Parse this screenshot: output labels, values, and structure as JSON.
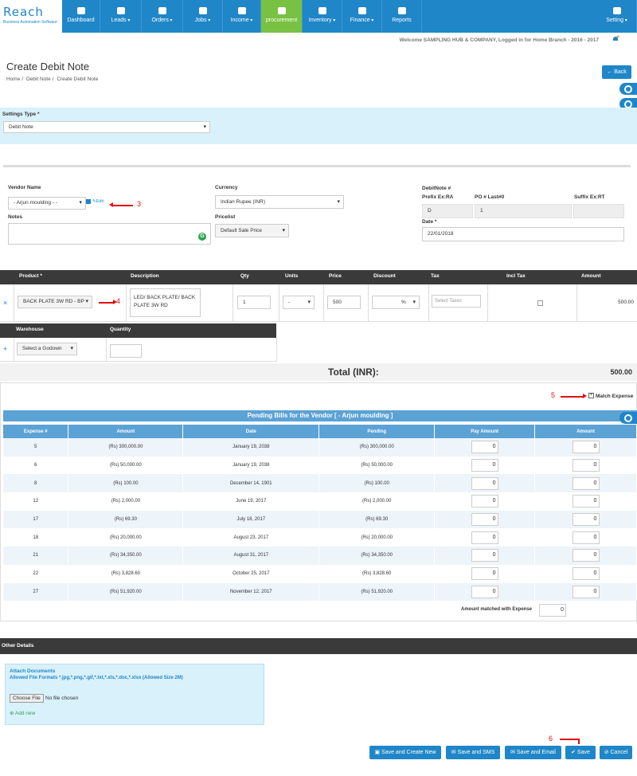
{
  "brand": {
    "logo": "Reach",
    "tagline": "Business Automation Software"
  },
  "nav": [
    {
      "label": "Dashboard",
      "icon": "dashboard-icon",
      "dropdown": false
    },
    {
      "label": "Leads",
      "icon": "leads-icon",
      "dropdown": true
    },
    {
      "label": "Orders",
      "icon": "orders-icon",
      "dropdown": true
    },
    {
      "label": "Jobs",
      "icon": "jobs-icon",
      "dropdown": true
    },
    {
      "label": "Income",
      "icon": "income-icon",
      "dropdown": true
    },
    {
      "label": "procurement",
      "icon": "procurement-icon",
      "dropdown": false
    },
    {
      "label": "Inventory",
      "icon": "inventory-icon",
      "dropdown": true
    },
    {
      "label": "Finance",
      "icon": "finance-icon",
      "dropdown": true
    },
    {
      "label": "Reports",
      "icon": "reports-icon",
      "dropdown": false
    },
    {
      "label": "Setting",
      "icon": "gear-icon",
      "dropdown": true
    }
  ],
  "welcome": "Welcome SAMPLING HUB & COMPANY, Logged in for Home Branch - 2016 - 2017",
  "page": {
    "title": "Create Debit Note",
    "breadcrumb": [
      "Home",
      "Debit Note",
      "Create Debit Note"
    ],
    "back_label": "Back"
  },
  "settings": {
    "label": "Settings Type *",
    "value": "Debit Note"
  },
  "form": {
    "vendor_label": "Vendor Name",
    "vendor_value": "- Arjun moulding - -",
    "edit_label": "Edit",
    "notes_label": "Notes",
    "currency_label": "Currency",
    "currency_value": "Indian Rupee (INR)",
    "pricelist_label": "Pricelist",
    "pricelist_value": "Default Sale Price",
    "debitnote_label": "DebitNote #",
    "prefix_label": "Prefix Ex:RA",
    "po_label": "PO # Last#0",
    "suffix_label": "Suffix Ex:RT",
    "prefix_value": "D",
    "po_value": "1",
    "suffix_value": "",
    "date_label": "Date *",
    "date_value": "22/01/2018"
  },
  "annotations": {
    "a3": "3",
    "a4": "4",
    "a5": "5",
    "a6": "6"
  },
  "products": {
    "headers": [
      "Product *",
      "Description",
      "Qty",
      "Units",
      "Price",
      "Discount",
      "Tax",
      "Incl Tax",
      "Amount"
    ],
    "row": {
      "product": "BACK PLATE 3W RD - BP",
      "description": "LED/ BACK PLATE/ BACK PLATE 3W RD",
      "qty": "1",
      "units": "-",
      "price": "500",
      "discount_type": "%",
      "tax_placeholder": "Select Taxes",
      "amount": "500.00"
    },
    "warehouse_headers": [
      "Warehouse",
      "Quantity"
    ],
    "warehouse_value": "Select a Godown"
  },
  "total": {
    "label": "Total (INR):",
    "value": "500.00"
  },
  "match_expense_label": "Match Expense",
  "pending": {
    "title": "Pending Bills for the Vendor [ - Arjun moulding ]",
    "headers": [
      "Expense #",
      "Amount",
      "Date",
      "Pending",
      "Pay Amount",
      "Amount"
    ],
    "rows": [
      {
        "expense": "5",
        "amount": "(Rs) 300,000.00",
        "date": "January 19, 2038",
        "pending": "(Rs) 300,000.00",
        "pay": "0",
        "amt": "0"
      },
      {
        "expense": "6",
        "amount": "(Rs) 50,000.00",
        "date": "January 19, 2038",
        "pending": "(Rs) 50,000.00",
        "pay": "0",
        "amt": "0"
      },
      {
        "expense": "8",
        "amount": "(Rs) 100.00",
        "date": "December 14, 1901",
        "pending": "(Rs) 100.00",
        "pay": "0",
        "amt": "0"
      },
      {
        "expense": "12",
        "amount": "(Rs) 2,000.00",
        "date": "June 19, 2017",
        "pending": "(Rs) 2,000.00",
        "pay": "0",
        "amt": "0"
      },
      {
        "expense": "17",
        "amount": "(Rs) 69.30",
        "date": "July 18, 2017",
        "pending": "(Rs) 69.30",
        "pay": "0",
        "amt": "0"
      },
      {
        "expense": "18",
        "amount": "(Rs) 20,000.00",
        "date": "August 23, 2017",
        "pending": "(Rs) 20,000.00",
        "pay": "0",
        "amt": "0"
      },
      {
        "expense": "21",
        "amount": "(Rs) 34,350.00",
        "date": "August 31, 2017",
        "pending": "(Rs) 34,350.00",
        "pay": "0",
        "amt": "0"
      },
      {
        "expense": "22",
        "amount": "(Rs) 3,828.60",
        "date": "October 25, 2017",
        "pending": "(Rs) 3,828.60",
        "pay": "0",
        "amt": "0"
      },
      {
        "expense": "27",
        "amount": "(Rs) 51,920.00",
        "date": "November 12, 2017",
        "pending": "(Rs) 51,920.00",
        "pay": "0",
        "amt": "0"
      }
    ],
    "matched_label": "Amount matched with Expense",
    "matched_value": "0"
  },
  "other": {
    "title": "Other Details",
    "attach_title": "Attach Documents",
    "attach_formats": "Allowed File Formats *.jpg,*.png,*.gif,*.txt,*.xls,*.doc,*.xlsx (Allowed Size 2M)",
    "choose_file": "Choose File",
    "no_file": "No file chosen",
    "add_new": "Add new"
  },
  "actions": {
    "save_create_new": "Save and Create New",
    "save_sms": "Save and SMS",
    "save_email": "Save and Email",
    "save": "Save",
    "cancel": "Cancel"
  },
  "colors": {
    "primary": "#1f86c8",
    "active_nav": "#79c142",
    "table_head": "#5ba2d5",
    "annotation": "#e01010"
  }
}
